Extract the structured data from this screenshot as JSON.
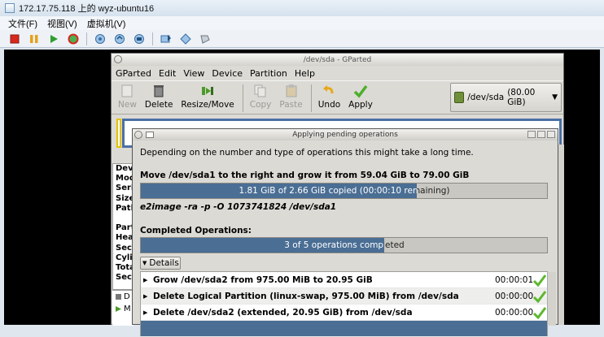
{
  "host": {
    "title": "172.17.75.118 上的 wyz-ubuntu16",
    "menu": [
      "文件(F)",
      "视图(V)",
      "虚拟机(V)"
    ]
  },
  "gparted": {
    "title": "/dev/sda - GParted",
    "menu": [
      "GParted",
      "Edit",
      "View",
      "Device",
      "Partition",
      "Help"
    ],
    "toolbar": {
      "new": "New",
      "delete": "Delete",
      "resize": "Resize/Move",
      "copy": "Copy",
      "paste": "Paste",
      "undo": "Undo",
      "apply": "Apply"
    },
    "device": {
      "name": "/dev/sda",
      "size": "(80.00 GiB)"
    },
    "info_labels": [
      "Dev",
      "Mod",
      "Seri",
      "Size",
      "Path",
      "",
      "Part",
      "Hea",
      "Sect",
      "Cyli",
      "Tota",
      "Sect"
    ],
    "ops_list": [
      "D",
      "M"
    ]
  },
  "dialog": {
    "title": "Applying pending operations",
    "message": "Depending on the number and type of operations this might take a long time.",
    "current_op": "Move /dev/sda1 to the right and grow it from 59.04 GiB to 79.00 GiB",
    "current_progress": {
      "text": "1.81 GiB of 2.66 GiB copied (00:00:10 remaining)",
      "fraction": 0.68
    },
    "command": "e2image -ra -p -O 1073741824 /dev/sda1",
    "completed_label": "Completed Operations:",
    "completed_progress": {
      "text": "3 of 5 operations completed",
      "fraction": 0.6
    },
    "details_label": "Details",
    "operations": [
      {
        "desc": "Grow /dev/sda2 from 975.00 MiB to 20.95 GiB",
        "time": "00:00:01"
      },
      {
        "desc": "Delete Logical Partition (linux-swap, 975.00 MiB) from /dev/sda",
        "time": "00:00:00"
      },
      {
        "desc": "Delete /dev/sda2 (extended, 20.95 GiB) from /dev/sda",
        "time": "00:00:00"
      }
    ]
  },
  "colors": {
    "accent": "#4a6e94",
    "check": "#5cb82e"
  }
}
